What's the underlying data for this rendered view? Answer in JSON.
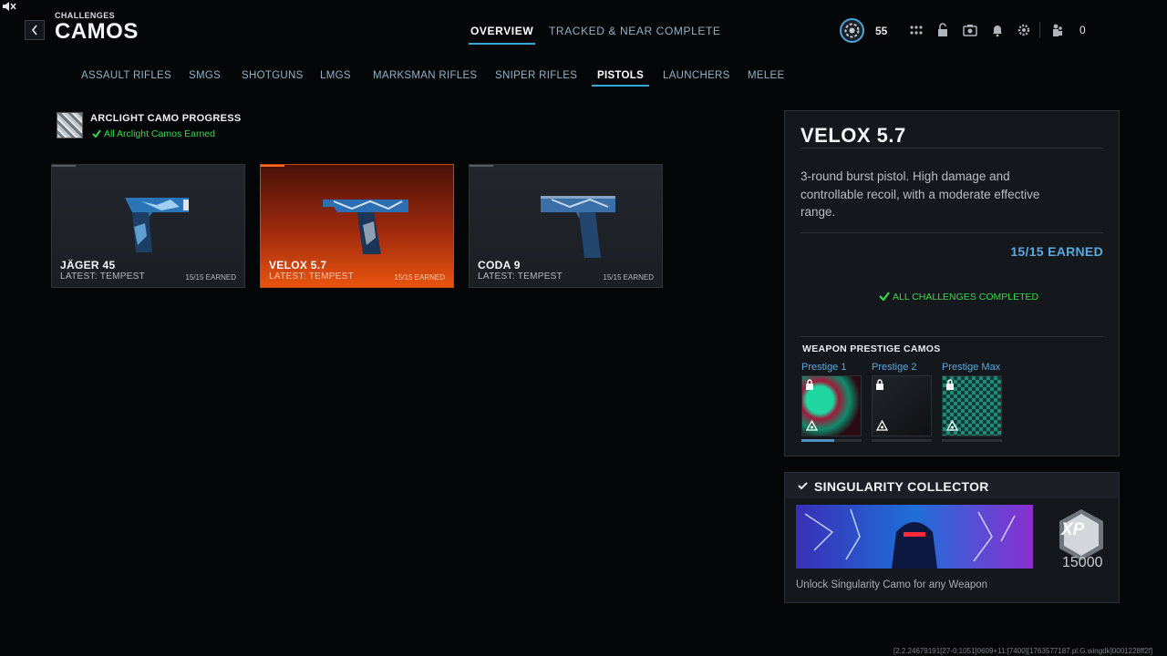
{
  "header": {
    "breadcrumb": "CHALLENGES",
    "title": "CAMOS",
    "tabs": [
      {
        "label": "OVERVIEW",
        "active": true
      },
      {
        "label": "TRACKED & NEAR COMPLETE",
        "active": false
      }
    ],
    "rank": "55",
    "friends_count": "0",
    "icons": [
      "apps-icon",
      "unlock-icon",
      "camera-icon",
      "bell-icon",
      "gear-icon",
      "friends-icon"
    ]
  },
  "categories": [
    {
      "label": "ASSAULT RIFLES",
      "active": false
    },
    {
      "label": "SMGS",
      "active": false
    },
    {
      "label": "SHOTGUNS",
      "active": false
    },
    {
      "label": "LMGS",
      "active": false
    },
    {
      "label": "MARKSMAN RIFLES",
      "active": false
    },
    {
      "label": "SNIPER RIFLES",
      "active": false
    },
    {
      "label": "PISTOLS",
      "active": true
    },
    {
      "label": "LAUNCHERS",
      "active": false
    },
    {
      "label": "MELEE",
      "active": false
    }
  ],
  "arclight": {
    "title": "ARCLIGHT CAMO PROGRESS",
    "status": "All Arclight Camos Earned"
  },
  "weapons": [
    {
      "name": "JÄGER 45",
      "latest": "LATEST: TEMPEST",
      "earned": "15/15 EARNED",
      "selected": false
    },
    {
      "name": "VELOX 5.7",
      "latest": "LATEST: TEMPEST",
      "earned": "15/15 EARNED",
      "selected": true
    },
    {
      "name": "CODA 9",
      "latest": "LATEST: TEMPEST",
      "earned": "15/15 EARNED",
      "selected": false
    }
  ],
  "detail": {
    "name": "VELOX 5.7",
    "description": "3-round burst pistol. High damage and controllable recoil, with a moderate effective range.",
    "earned": "15/15 EARNED",
    "challenges_status": "ALL CHALLENGES COMPLETED",
    "prestige_heading": "WEAPON PRESTIGE CAMOS",
    "prestige": [
      {
        "label": "Prestige 1",
        "progress": 0.55
      },
      {
        "label": "Prestige 2",
        "progress": 0
      },
      {
        "label": "Prestige Max",
        "progress": 0
      }
    ]
  },
  "collector": {
    "title": "SINGULARITY COLLECTOR",
    "xp_label": "XP",
    "xp_value": "15000",
    "description": "Unlock Singularity Camo for any Weapon"
  },
  "footer_code": "[2.2.24679191[27-0:1051]0609+11:[7400][1763577187.pl.G.wingdk]0001228ff2f]",
  "colors": {
    "accent": "#34a7d8",
    "selected_card": "#e8540f",
    "success": "#37d94a",
    "earned_text": "#5aa9df"
  }
}
